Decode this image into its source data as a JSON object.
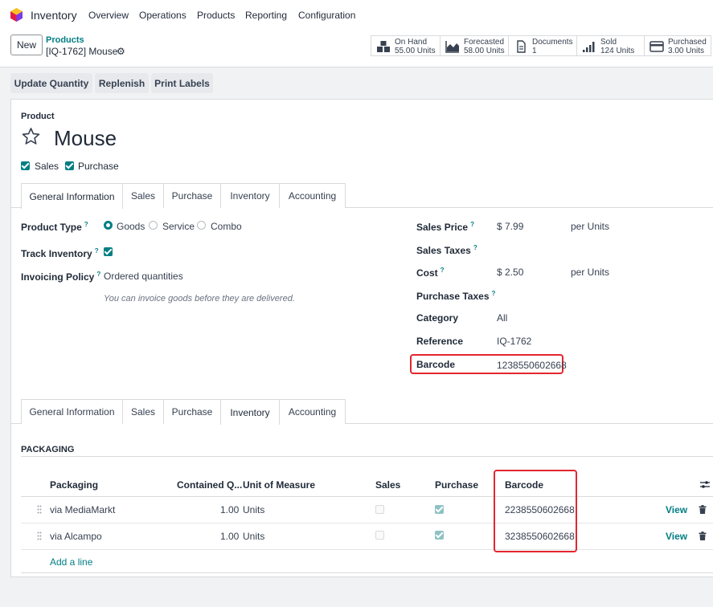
{
  "app": {
    "name": "Inventory"
  },
  "menu": [
    "Overview",
    "Operations",
    "Products",
    "Reporting",
    "Configuration"
  ],
  "control_panel": {
    "new_label": "New",
    "breadcrumb_parent": "Products",
    "breadcrumb_current": "[IQ-1762] Mouse"
  },
  "stats": [
    {
      "label": "On Hand",
      "value": "55.00 Units",
      "icon": "cubes-icon"
    },
    {
      "label": "Forecasted",
      "value": "58.00 Units",
      "icon": "area-chart-icon"
    },
    {
      "label": "Documents",
      "value": "1",
      "icon": "document-icon"
    },
    {
      "label": "Sold",
      "value": "124 Units",
      "icon": "signal-icon"
    },
    {
      "label": "Purchased",
      "value": "3.00 Units",
      "icon": "credit-card-icon"
    }
  ],
  "actions": [
    "Update Quantity",
    "Replenish",
    "Print Labels"
  ],
  "product": {
    "caption": "Product",
    "name": "Mouse",
    "sales_label": "Sales",
    "purchase_label": "Purchase"
  },
  "tabs": [
    "General Information",
    "Sales",
    "Purchase",
    "Inventory",
    "Accounting"
  ],
  "general": {
    "product_type_label": "Product Type",
    "product_type_options": [
      "Goods",
      "Service",
      "Combo"
    ],
    "track_inventory_label": "Track Inventory",
    "invoicing_policy_label": "Invoicing Policy",
    "invoicing_policy_value": "Ordered quantities",
    "invoicing_hint": "You can invoice goods before they are delivered.",
    "sales_price_label": "Sales Price",
    "sales_price_value": "$ 7.99",
    "sales_price_unit": "per Units",
    "sales_taxes_label": "Sales Taxes",
    "cost_label": "Cost",
    "cost_value": "$ 2.50",
    "cost_unit": "per Units",
    "purchase_taxes_label": "Purchase Taxes",
    "category_label": "Category",
    "category_value": "All",
    "reference_label": "Reference",
    "reference_value": "IQ-1762",
    "barcode_label": "Barcode",
    "barcode_value": "1238550602668"
  },
  "packaging": {
    "section_title": "PACKAGING",
    "columns": [
      "Packaging",
      "Contained Q...",
      "Unit of Measure",
      "Sales",
      "Purchase",
      "Barcode"
    ],
    "rows": [
      {
        "name": "via MediaMarkt",
        "qty": "1.00",
        "uom": "Units",
        "sales": false,
        "purchase": true,
        "barcode": "2238550602668",
        "view": "View"
      },
      {
        "name": "via Alcampo",
        "qty": "1.00",
        "uom": "Units",
        "sales": false,
        "purchase": true,
        "barcode": "3238550602668",
        "view": "View"
      }
    ],
    "add_line": "Add a line"
  },
  "colors": {
    "accent": "#017e84",
    "highlight": "#e3262e",
    "brand": "#714b67"
  }
}
